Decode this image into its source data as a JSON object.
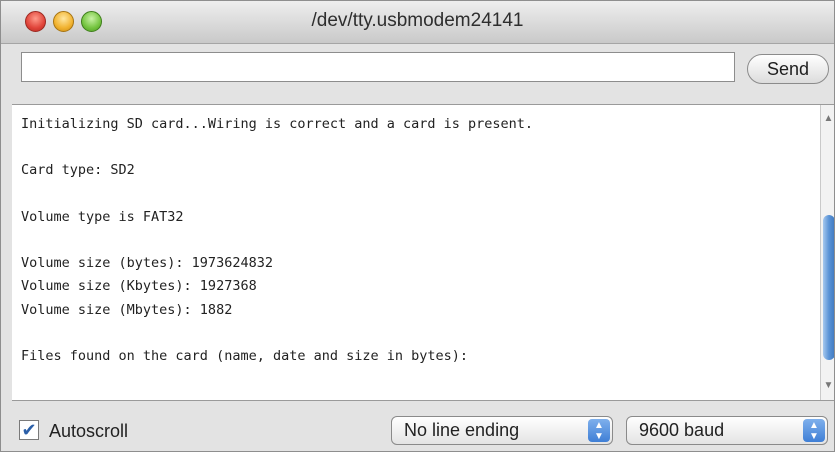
{
  "window": {
    "title": "/dev/tty.usbmodem24141"
  },
  "input": {
    "value": "",
    "placeholder": "",
    "send_label": "Send"
  },
  "output": {
    "lines": [
      "Initializing SD card...Wiring is correct and a card is present.",
      "",
      "Card type: SD2",
      "",
      "Volume type is FAT32",
      "",
      "Volume size (bytes): 1973624832",
      "Volume size (Kbytes): 1927368",
      "Volume size (Mbytes): 1882",
      "",
      "Files found on the card (name, date and size in bytes):"
    ]
  },
  "footer": {
    "autoscroll_label": "Autoscroll",
    "autoscroll_checked": true,
    "line_ending": "No line ending",
    "baud_rate": "9600 baud"
  },
  "icons": {
    "close": "close-circle-icon",
    "minimize": "minimize-circle-icon",
    "zoom": "zoom-circle-icon",
    "checkbox": "checkmark-icon",
    "select_arrows": "up-down-arrows-icon",
    "scroll_up": "scroll-up-arrow-icon",
    "scroll_down": "scroll-down-arrow-icon"
  },
  "colors": {
    "accent_blue": "#3f7fd6",
    "close": "#e0443a",
    "minimize": "#f1b22f",
    "zoom": "#74c43f"
  }
}
